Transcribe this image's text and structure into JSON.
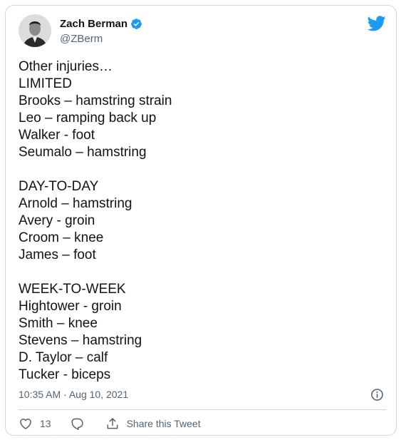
{
  "author": {
    "name": "Zach Berman",
    "handle": "@ZBerm",
    "verified": true,
    "avatar_icon": "profile-photo"
  },
  "tweet": {
    "lines": [
      "Other injuries…",
      "LIMITED",
      "Brooks – hamstring strain",
      "Leo – ramping back up",
      "Walker - foot",
      "Seumalo – hamstring",
      "",
      "DAY-TO-DAY",
      "Arnold – hamstring",
      "Avery - groin",
      "Croom – knee",
      "James – foot",
      "",
      "WEEK-TO-WEEK",
      "Hightower - groin",
      "Smith – knee",
      "Stevens – hamstring",
      "D. Taylor – calf",
      "Tucker - biceps"
    ],
    "timestamp": "10:35 AM · Aug 10, 2021"
  },
  "actions": {
    "like_count": "13",
    "share_label": "Share this Tweet"
  },
  "colors": {
    "twitter_blue": "#1d9bf0",
    "text": "#0f1419",
    "muted": "#536471",
    "border": "#cfd9de"
  }
}
